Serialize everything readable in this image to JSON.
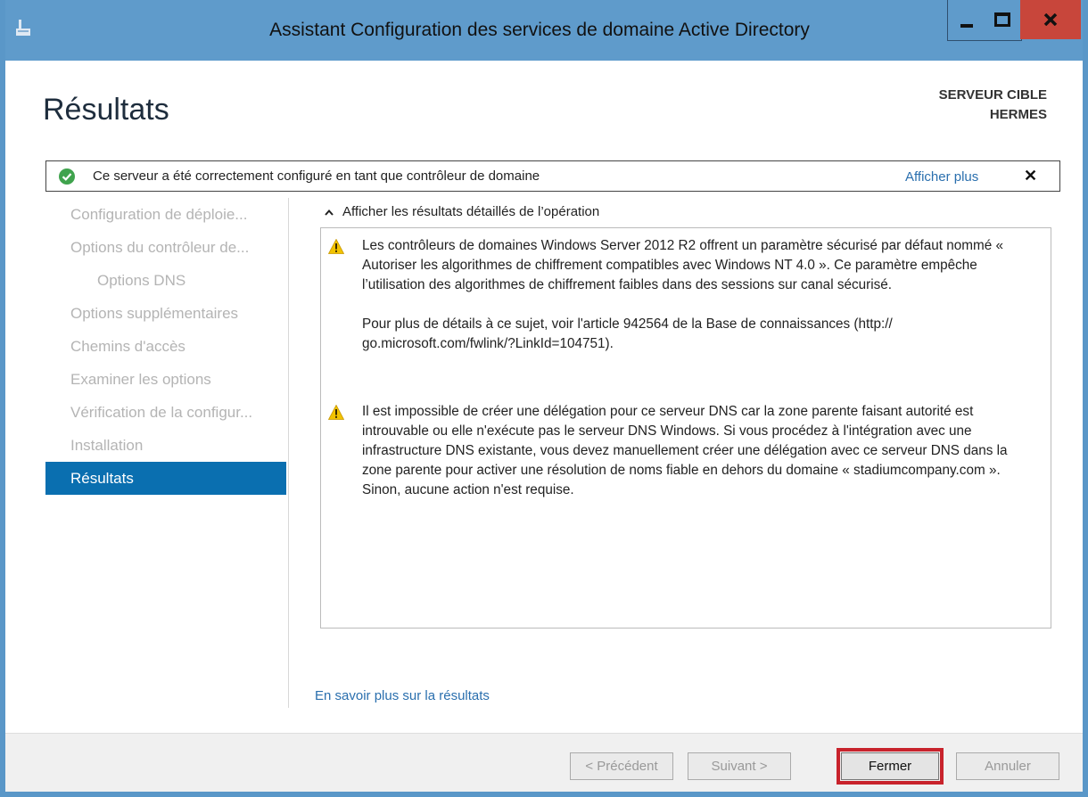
{
  "window": {
    "title": "Assistant Configuration des services de domaine Active Directory",
    "controls": {
      "minimize": "minimize",
      "maximize": "maximize",
      "close": "close"
    }
  },
  "header": {
    "page_title": "Résultats",
    "target_server_label": "SERVEUR CIBLE",
    "target_server_name": "HERMES"
  },
  "notification": {
    "text": "Ce serveur a été correctement configuré en tant que contrôleur de domaine",
    "more_link": "Afficher plus",
    "close_glyph": "✕"
  },
  "sidebar": {
    "items": [
      {
        "label": "Configuration de déploie...",
        "state": "disabled"
      },
      {
        "label": "Options du contrôleur de...",
        "state": "disabled"
      },
      {
        "label": "Options DNS",
        "state": "disabled",
        "indent": true
      },
      {
        "label": "Options supplémentaires",
        "state": "disabled"
      },
      {
        "label": "Chemins d'accès",
        "state": "disabled"
      },
      {
        "label": "Examiner les options",
        "state": "disabled"
      },
      {
        "label": "Vérification de la configur...",
        "state": "disabled"
      },
      {
        "label": "Installation",
        "state": "disabled"
      },
      {
        "label": "Résultats",
        "state": "active"
      }
    ]
  },
  "main": {
    "details_toggle": "Afficher les résultats détaillés de l’opération",
    "messages": [
      {
        "icon": "warning-icon",
        "paragraph1": "Les contrôleurs de domaines Windows Server 2012 R2 offrent un paramètre sécurisé par défaut nommé « Autoriser les algorithmes de chiffrement compatibles avec Windows NT 4.0 ». Ce paramètre empêche l’utilisation des algorithmes de chiffrement faibles dans des sessions sur canal sécurisé.",
        "paragraph2": "Pour plus de détails à ce sujet, voir l'article 942564 de la Base de connaissances (http:// go.microsoft.com/fwlink/?LinkId=104751)."
      },
      {
        "icon": "warning-icon",
        "paragraph1": "Il est impossible de créer une délégation pour ce serveur DNS car la zone parente faisant autorité est introuvable ou elle n'exécute pas le serveur DNS Windows. Si vous procédez à l'intégration avec une infrastructure DNS existante, vous devez manuellement créer une délégation avec ce serveur DNS dans la zone parente pour activer une résolution de noms fiable en dehors du domaine « stadiumcompany.com ». Sinon, aucune action n'est requise."
      }
    ],
    "learn_more_link": "En savoir plus sur la résultats"
  },
  "footer": {
    "prev_label": "< Précédent",
    "next_label": "Suivant >",
    "close_label": "Fermer",
    "cancel_label": "Annuler"
  },
  "colors": {
    "titlebar": "#5f9bcb",
    "close_button": "#c8463b",
    "sidebar_active": "#0a6fb0",
    "link": "#2a6fae",
    "highlight_outline": "#c8232c",
    "warning": "#f2c300",
    "success": "#3fa34d"
  }
}
